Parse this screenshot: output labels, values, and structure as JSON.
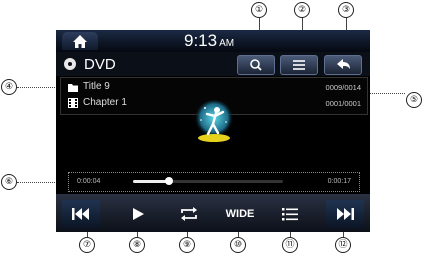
{
  "status": {
    "time": "9:13",
    "ampm": "AM"
  },
  "source": {
    "title": "DVD"
  },
  "info": {
    "title_label": "Title 9",
    "title_count": "0009/0014",
    "chapter_label": "Chapter 1",
    "chapter_count": "0001/0001"
  },
  "progress": {
    "elapsed": "0:00:04",
    "total": "0:00:17",
    "fraction": 0.24
  },
  "controls": {
    "wide_label": "WIDE"
  },
  "callouts": [
    "①",
    "②",
    "③",
    "④",
    "⑤",
    "⑥",
    "⑦",
    "⑧",
    "⑨",
    "⑩",
    "⑪",
    "⑫"
  ],
  "colors": {
    "screen": "#000000",
    "bar_top": "#1b2a44",
    "bar_bottom": "#0c1019",
    "accent": "#ffffff"
  }
}
